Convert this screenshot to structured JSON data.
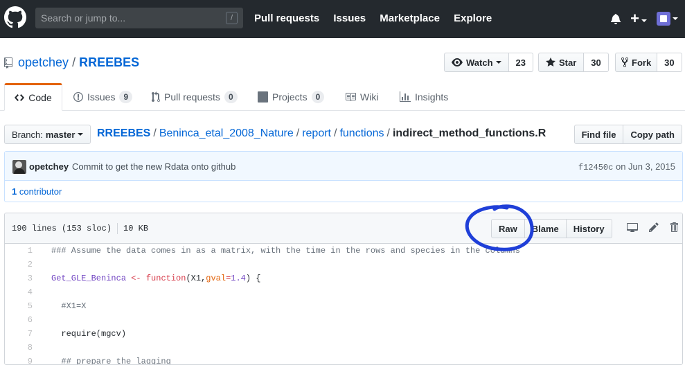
{
  "header": {
    "search_placeholder": "Search or jump to...",
    "search_shortcut": "/",
    "nav": [
      "Pull requests",
      "Issues",
      "Marketplace",
      "Explore"
    ]
  },
  "repo": {
    "owner": "opetchey",
    "separator": "/",
    "name": "RREEBES",
    "watch_label": "Watch",
    "watch_count": "23",
    "star_label": "Star",
    "star_count": "30",
    "fork_label": "Fork",
    "fork_count": "30"
  },
  "tabs": {
    "code": "Code",
    "issues": "Issues",
    "issues_count": "9",
    "pulls": "Pull requests",
    "pulls_count": "0",
    "projects": "Projects",
    "projects_count": "0",
    "wiki": "Wiki",
    "insights": "Insights"
  },
  "breadcrumb": {
    "branch_label": "Branch:",
    "branch_name": "master",
    "parts": [
      "RREEBES",
      "Beninca_etal_2008_Nature",
      "report",
      "functions"
    ],
    "file": "indirect_method_functions.R",
    "find_file": "Find file",
    "copy_path": "Copy path"
  },
  "commit": {
    "author": "opetchey",
    "message": "Commit to get the new Rdata onto github",
    "sha": "f12450c",
    "date": "on Jun 3, 2015",
    "contributors_count": "1",
    "contributors_label": "contributor"
  },
  "file": {
    "lines_info": "190 lines (153 sloc)",
    "size": "10 KB",
    "raw": "Raw",
    "blame": "Blame",
    "history": "History"
  },
  "code_lines": [
    {
      "n": "1",
      "text": "### Assume the data comes in as a matrix, with the time in the rows and species in the columns"
    },
    {
      "n": "2",
      "text": ""
    },
    {
      "n": "3",
      "text": "Get_GLE_Beninca <- function(X1,gval=1.4) {"
    },
    {
      "n": "4",
      "text": ""
    },
    {
      "n": "5",
      "text": "  #X1=X"
    },
    {
      "n": "6",
      "text": ""
    },
    {
      "n": "7",
      "text": "  require(mgcv)"
    },
    {
      "n": "8",
      "text": ""
    },
    {
      "n": "9",
      "text": "  ## prepare the lagging"
    }
  ],
  "colors": {
    "header_bg": "#24292e",
    "link": "#0366d6",
    "active_tab": "#e36209",
    "annotation": "#1f3fd8"
  }
}
